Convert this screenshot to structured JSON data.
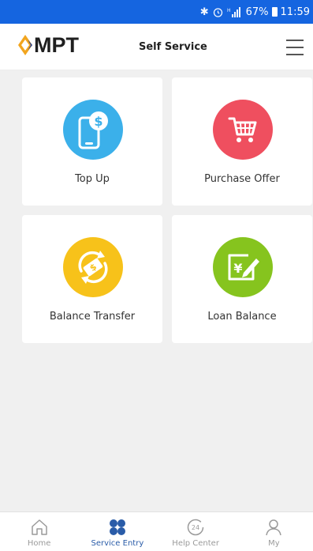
{
  "status_bar": {
    "battery": "67%",
    "time": "11:59",
    "icons": [
      "bluetooth-icon",
      "alarm-icon",
      "signal-icon",
      "battery-icon"
    ]
  },
  "header": {
    "logo_text": "MPT",
    "title": "Self Service",
    "menu_icon": "hamburger-menu-icon"
  },
  "cards": [
    {
      "label": "Top Up",
      "icon": "phone-dollar-icon",
      "color": "#3bb0ea"
    },
    {
      "label": "Purchase Offer",
      "icon": "shopping-cart-icon",
      "color": "#ef4f5f"
    },
    {
      "label": "Balance Transfer",
      "icon": "money-transfer-icon",
      "color": "#f7c21a"
    },
    {
      "label": "Loan Balance",
      "icon": "yen-note-pen-icon",
      "color": "#86c41e"
    }
  ],
  "bottom_nav": [
    {
      "label": "Home",
      "icon": "home-icon",
      "active": false
    },
    {
      "label": "Service Entry",
      "icon": "service-grid-icon",
      "active": true
    },
    {
      "label": "Help Center",
      "icon": "help-24-icon",
      "active": false
    },
    {
      "label": "My",
      "icon": "person-icon",
      "active": false
    }
  ],
  "colors": {
    "status_bar": "#1565e0",
    "background": "#f0f0f0",
    "nav_active": "#2a5ca8",
    "nav_inactive": "#9a9a9a",
    "logo_gold": "#f2a51e",
    "logo_blue": "#1f3f9a"
  }
}
